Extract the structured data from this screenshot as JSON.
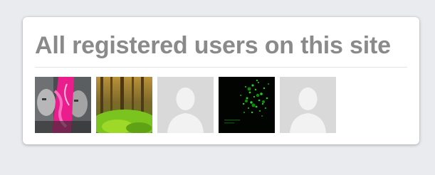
{
  "widget": {
    "title": "All registered users on this site"
  },
  "users": [
    {
      "avatar": "user-photo-pink-graphic"
    },
    {
      "avatar": "user-photo-forest"
    },
    {
      "avatar": "default-user-silhouette"
    },
    {
      "avatar": "user-photo-green-particles"
    },
    {
      "avatar": "default-user-silhouette"
    }
  ],
  "colors": {
    "page_background": "#e9ebee",
    "card_background": "#ffffff",
    "title_text": "#8a8a8a",
    "divider": "#e3e3e3",
    "placeholder_avatar": "#d9d9d9"
  }
}
